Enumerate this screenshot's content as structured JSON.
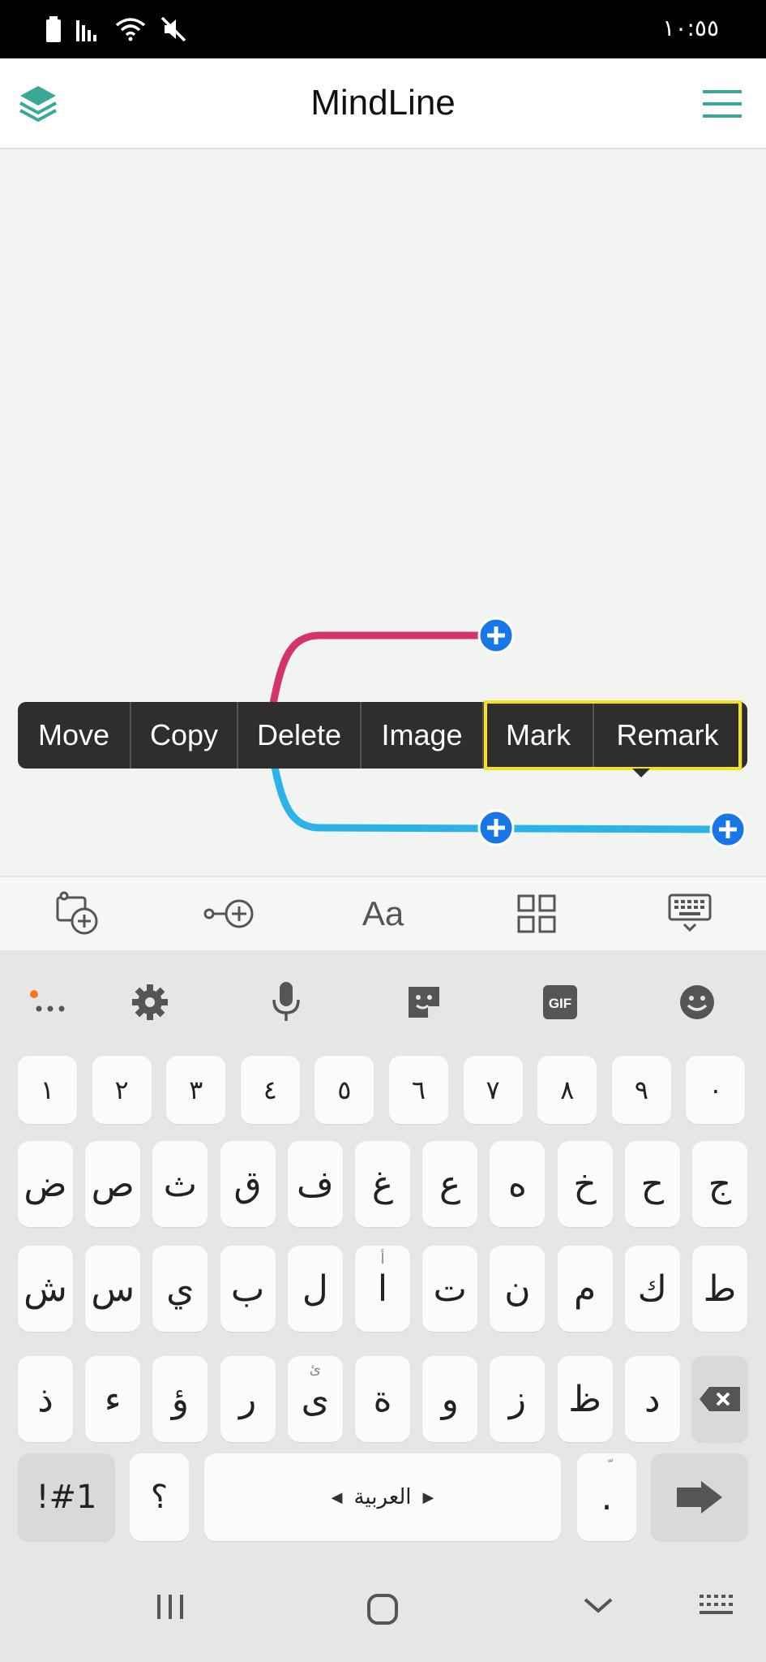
{
  "status_bar": {
    "time": "١٠:٥٥",
    "icons": [
      "battery-icon",
      "signal-icon",
      "wifi-icon",
      "mute-icon"
    ]
  },
  "header": {
    "title": "MindLine",
    "left_icon": "layers-icon",
    "right_icon": "hamburger-menu-icon"
  },
  "canvas": {
    "branch_colors": {
      "top": "#d6336c",
      "middle": "#6b1a3a",
      "bottom": "#2bb3e8"
    },
    "add_node_color": "#1877e8"
  },
  "context_menu": {
    "items": [
      "Move",
      "Copy",
      "Delete",
      "Image",
      "Mark",
      "Remark"
    ],
    "highlight_color": "#f5e21b"
  },
  "toolbar": {
    "tools": [
      {
        "name": "add-child-node-icon"
      },
      {
        "name": "add-sibling-node-icon"
      },
      {
        "name": "text-style-icon",
        "label": "Aa"
      },
      {
        "name": "layout-grid-icon"
      },
      {
        "name": "hide-keyboard-icon"
      }
    ]
  },
  "keyboard": {
    "top_icons": [
      "more-icon",
      "settings-icon",
      "microphone-icon",
      "sticker-icon",
      "gif-icon",
      "emoji-icon"
    ],
    "gif_label": "GIF",
    "row1": [
      "١",
      "٢",
      "٣",
      "٤",
      "٥",
      "٦",
      "٧",
      "٨",
      "٩",
      "٠"
    ],
    "row2": [
      "ض",
      "ص",
      "ث",
      "ق",
      "ف",
      "غ",
      "ع",
      "ه",
      "خ",
      "ح",
      "ج"
    ],
    "row3": [
      "ش",
      "س",
      "ي",
      "ب",
      "ل",
      "ا",
      "ت",
      "ن",
      "م",
      "ك",
      "ط"
    ],
    "row3_hints": {
      "5": "أ"
    },
    "row4": [
      "ذ",
      "ء",
      "ؤ",
      "ر",
      "ى",
      "ة",
      "و",
      "ز",
      "ظ",
      "د"
    ],
    "row4_hints": {
      "4": "ئ"
    },
    "symbols_label": "!#1",
    "question_label": "؟",
    "space_label": "العربية",
    "period_label": ".",
    "period_hint": "ّ"
  },
  "nav_bar": {
    "icons": [
      "recent-apps-icon",
      "home-icon",
      "back-icon",
      "keyboard-switch-icon"
    ]
  }
}
